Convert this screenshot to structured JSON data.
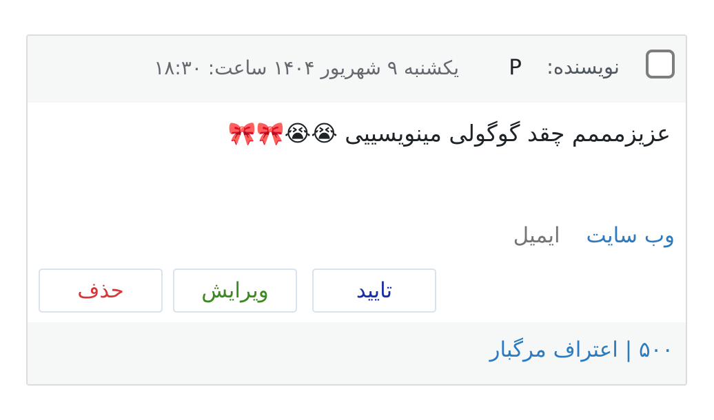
{
  "comment": {
    "author_label": "نویسنده:",
    "author_name": "P",
    "date": "یکشنبه ۹ شهریور ۱۴۰۴ ساعت: ۱۸:۳۰",
    "text": "عزیزمممم چقد گوگولی مینویسییی 😭😭🎀🎀",
    "links": {
      "website": "وب سایت",
      "email": "ایمیل"
    }
  },
  "actions": {
    "approve": "تایید",
    "edit": "ویرایش",
    "delete": "حذف"
  },
  "footer": {
    "post_link": "۵۰۰ | اعتراف مرگبار"
  },
  "colors": {
    "link": "#2c7bc0",
    "approve": "#1a2ea8",
    "edit": "#3a8a1f",
    "delete": "#d63638"
  }
}
